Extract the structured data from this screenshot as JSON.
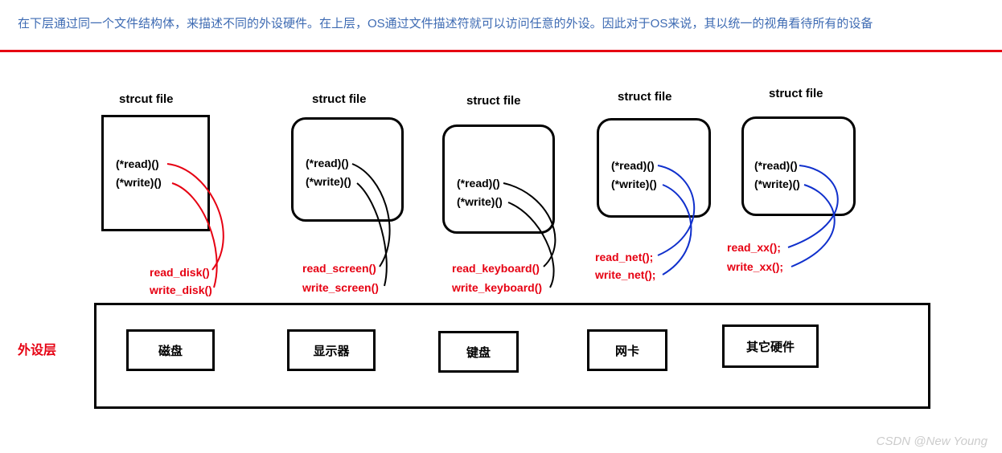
{
  "caption": "在下层通过同一个文件结构体，来描述不同的外设硬件。在上层，OS通过文件描述符就可以访问任意的外设。因此对于OS来说，其以统一的视角看待所有的设备",
  "structs": [
    {
      "label": "strcut file",
      "read": "(*read)()",
      "write": "(*write)()",
      "drv_read": "read_disk()",
      "drv_write": "write_disk()"
    },
    {
      "label": "struct file",
      "read": "(*read)()",
      "write": "(*write)()",
      "drv_read": "read_screen()",
      "drv_write": "write_screen()"
    },
    {
      "label": "struct file",
      "read": "(*read)()",
      "write": "(*write)()",
      "drv_read": "read_keyboard()",
      "drv_write": "write_keyboard()"
    },
    {
      "label": "struct file",
      "read": "(*read)()",
      "write": "(*write)()",
      "drv_read": "read_net();",
      "drv_write": "write_net();"
    },
    {
      "label": "struct file",
      "read": "(*read)()",
      "write": "(*write)()",
      "drv_read": "read_xx();",
      "drv_write": "write_xx();"
    }
  ],
  "layer_label": "外设层",
  "devices": [
    "磁盘",
    "显示器",
    "键盘",
    "网卡",
    "其它硬件"
  ],
  "watermark": "CSDN @New  Young"
}
